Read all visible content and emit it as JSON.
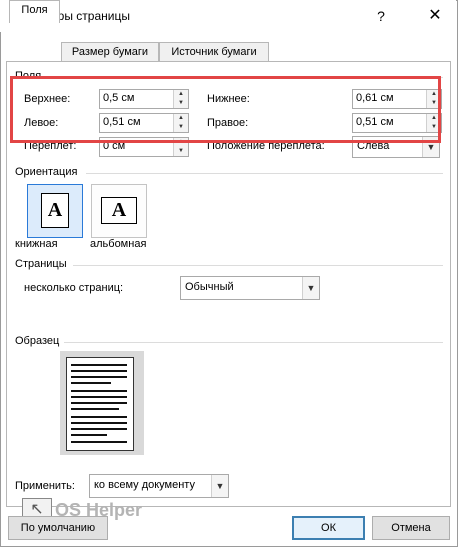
{
  "window": {
    "title": "Параметры страницы",
    "help_glyph": "?",
    "close_glyph": "✕"
  },
  "tabs": [
    {
      "label": "Поля",
      "active": true
    },
    {
      "label": "Размер бумаги",
      "active": false
    },
    {
      "label": "Источник бумаги",
      "active": false
    }
  ],
  "margins": {
    "section_label": "Поля",
    "top_label": "Верхнее:",
    "top_value": "0,5 см",
    "bottom_label": "Нижнее:",
    "bottom_value": "0,61 см",
    "left_label": "Левое:",
    "left_value": "0,51 см",
    "right_label": "Правое:",
    "right_value": "0,51 см",
    "gutter_label": "Переплет:",
    "gutter_value": "0 см",
    "gutter_pos_label": "Положение переплета:",
    "gutter_pos_value": "Слева"
  },
  "orientation": {
    "section_label": "Ориентация",
    "portrait_glyph": "A",
    "landscape_glyph": "A",
    "portrait_label": "книжная",
    "landscape_label": "альбомная",
    "selected": "portrait"
  },
  "pages": {
    "section_label": "Страницы",
    "multiple_label": "несколько страниц:",
    "multiple_value": "Обычный"
  },
  "preview": {
    "section_label": "Образец"
  },
  "apply": {
    "label": "Применить:",
    "value": "ко всему документу"
  },
  "buttons": {
    "default_label": "По умолчанию",
    "ok_label": "ОК",
    "cancel_label": "Отмена"
  },
  "watermark": {
    "text": "OS Helper",
    "glyph": "↖"
  },
  "colors": {
    "highlight": "#e24545",
    "selected_border": "#2a7ad8"
  }
}
